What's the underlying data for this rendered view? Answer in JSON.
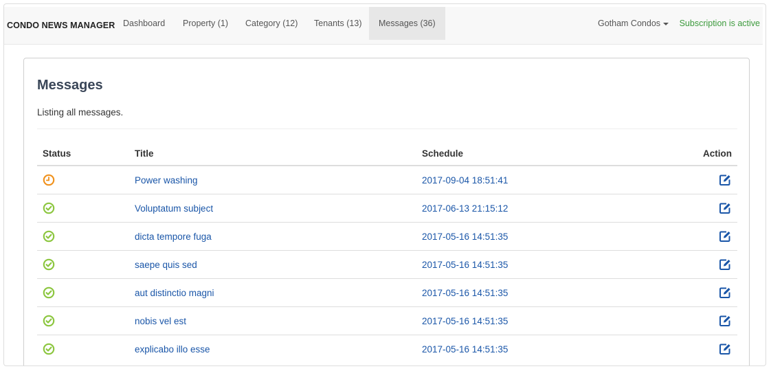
{
  "navbar": {
    "brand": "CONDO NEWS MANAGER",
    "links": [
      {
        "label": "Dashboard"
      },
      {
        "label": "Property (1)"
      },
      {
        "label": "Category (12)"
      },
      {
        "label": "Tenants (13)"
      },
      {
        "label": "Messages (36)",
        "active": true
      }
    ],
    "account": "Gotham Condos",
    "subscription": "Subscription is active"
  },
  "page": {
    "title": "Messages",
    "subtitle": "Listing all messages."
  },
  "table": {
    "headers": {
      "status": "Status",
      "title": "Title",
      "schedule": "Schedule",
      "action": "Action"
    },
    "rows": [
      {
        "status": "scheduled",
        "title": "Power washing",
        "schedule": "2017-09-04 18:51:41"
      },
      {
        "status": "sent",
        "title": "Voluptatum subject",
        "schedule": "2017-06-13 21:15:12"
      },
      {
        "status": "sent",
        "title": "dicta tempore fuga",
        "schedule": "2017-05-16 14:51:35"
      },
      {
        "status": "sent",
        "title": "saepe quis sed",
        "schedule": "2017-05-16 14:51:35"
      },
      {
        "status": "sent",
        "title": "aut distinctio magni",
        "schedule": "2017-05-16 14:51:35"
      },
      {
        "status": "sent",
        "title": "nobis vel est",
        "schedule": "2017-05-16 14:51:35"
      },
      {
        "status": "sent",
        "title": "explicabo illo esse",
        "schedule": "2017-05-16 14:51:35"
      }
    ]
  },
  "icons": {
    "scheduled": "clock-icon",
    "sent": "check-circle-icon",
    "edit": "edit-icon"
  },
  "colors": {
    "scheduled": "#f0921e",
    "sent": "#8cc63f",
    "link": "#1a56a8",
    "subscription": "#3c9a3c",
    "edit": "#1a56a8"
  }
}
